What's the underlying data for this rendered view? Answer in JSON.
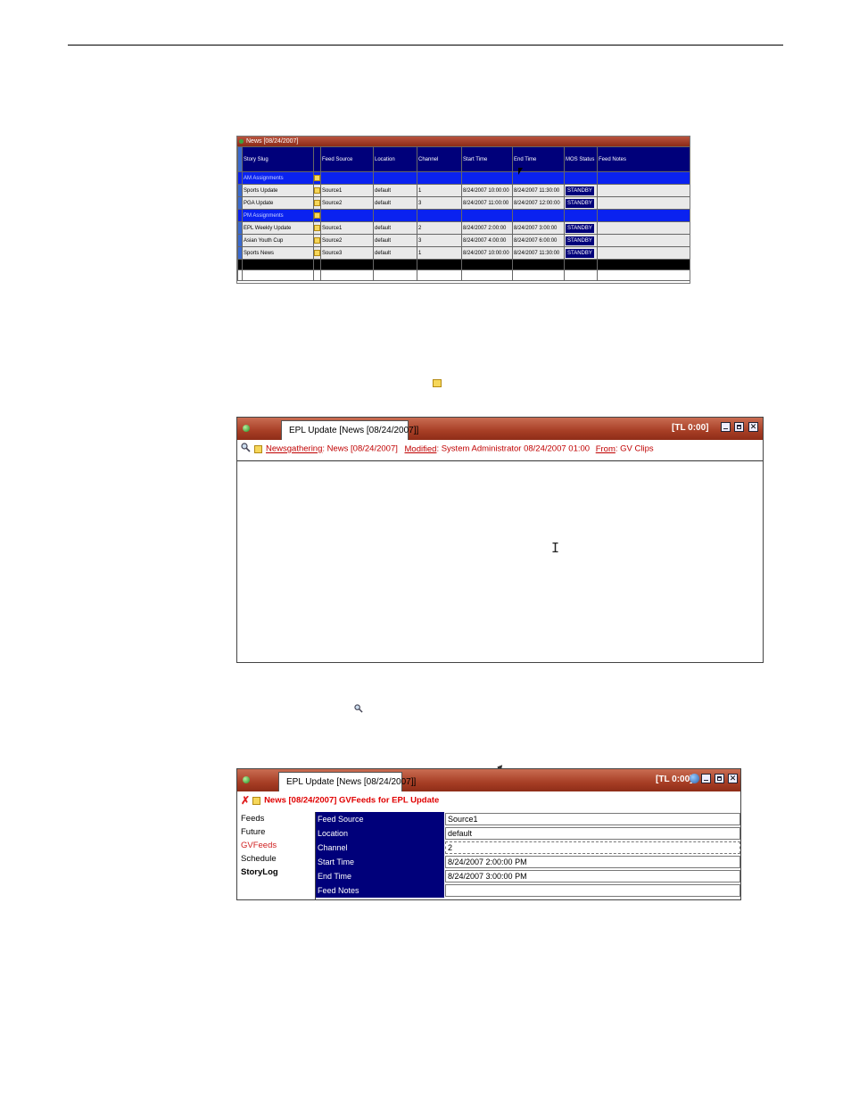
{
  "grid": {
    "title": "News [08/24/2007]",
    "columns": [
      "Story Slug",
      "Feed Source",
      "Location",
      "Channel",
      "Start Time",
      "End Time",
      "MOS Status",
      "Feed Notes"
    ],
    "rows": [
      {
        "type": "group",
        "slug": "AM Assignments"
      },
      {
        "type": "item",
        "slug": "Sports Update",
        "source": "Source1",
        "location": "default",
        "channel": "1",
        "start": "8/24/2007 10:00:00",
        "end": "8/24/2007 11:30:00",
        "status": "STANDBY"
      },
      {
        "type": "item",
        "slug": "PGA Update",
        "source": "Source2",
        "location": "default",
        "channel": "3",
        "start": "8/24/2007 11:00:00",
        "end": "8/24/2007 12:00:00",
        "status": "STANDBY"
      },
      {
        "type": "group",
        "slug": "PM Assignments"
      },
      {
        "type": "item",
        "slug": "EPL Weekly Update",
        "source": "Source1",
        "location": "default",
        "channel": "2",
        "start": "8/24/2007 2:00:00",
        "end": "8/24/2007 3:00:00",
        "status": "STANDBY"
      },
      {
        "type": "item",
        "slug": "Asian Youth Cup",
        "source": "Source2",
        "location": "default",
        "channel": "3",
        "start": "8/24/2007 4:00:00",
        "end": "8/24/2007 6:00:00",
        "status": "STANDBY"
      },
      {
        "type": "item",
        "slug": "Sports News",
        "source": "Source3",
        "location": "default",
        "channel": "1",
        "start": "8/24/2007 10:00:00",
        "end": "8/24/2007 11:30:00",
        "status": "STANDBY"
      }
    ]
  },
  "editor": {
    "tab": "EPL Update [News [08/24/2007]]",
    "timecode": "[TL 0:00]",
    "info": {
      "newsgathering_label": "Newsgathering",
      "newsgathering_value": ": News [08/24/2007]",
      "modified_label": "Modified",
      "modified_value": ": System Administrator  08/24/2007 01:00",
      "from_label": "From",
      "from_value": ": GV Clips"
    }
  },
  "feeds": {
    "tab": "EPL Update [News [08/24/2007]]",
    "timecode": "[TL 0:00]",
    "header": "News [08/24/2007]   GVFeeds for EPL Update",
    "nav": [
      "Feeds",
      "Future",
      "GVFeeds",
      "Schedule",
      "StoryLog"
    ],
    "fields": [
      {
        "label": "Feed Source",
        "value": "Source1"
      },
      {
        "label": "Location",
        "value": "default"
      },
      {
        "label": "Channel",
        "value": "2"
      },
      {
        "label": "Start Time",
        "value": "8/24/2007 2:00:00 PM"
      },
      {
        "label": "End Time",
        "value": "8/24/2007 3:00:00 PM"
      },
      {
        "label": "Feed Notes",
        "value": ""
      }
    ]
  },
  "colors": {
    "titlebar": "#a73e25",
    "header_blue": "#00007a",
    "group_blue": "#0a22f0",
    "link_red": "#c00000"
  }
}
